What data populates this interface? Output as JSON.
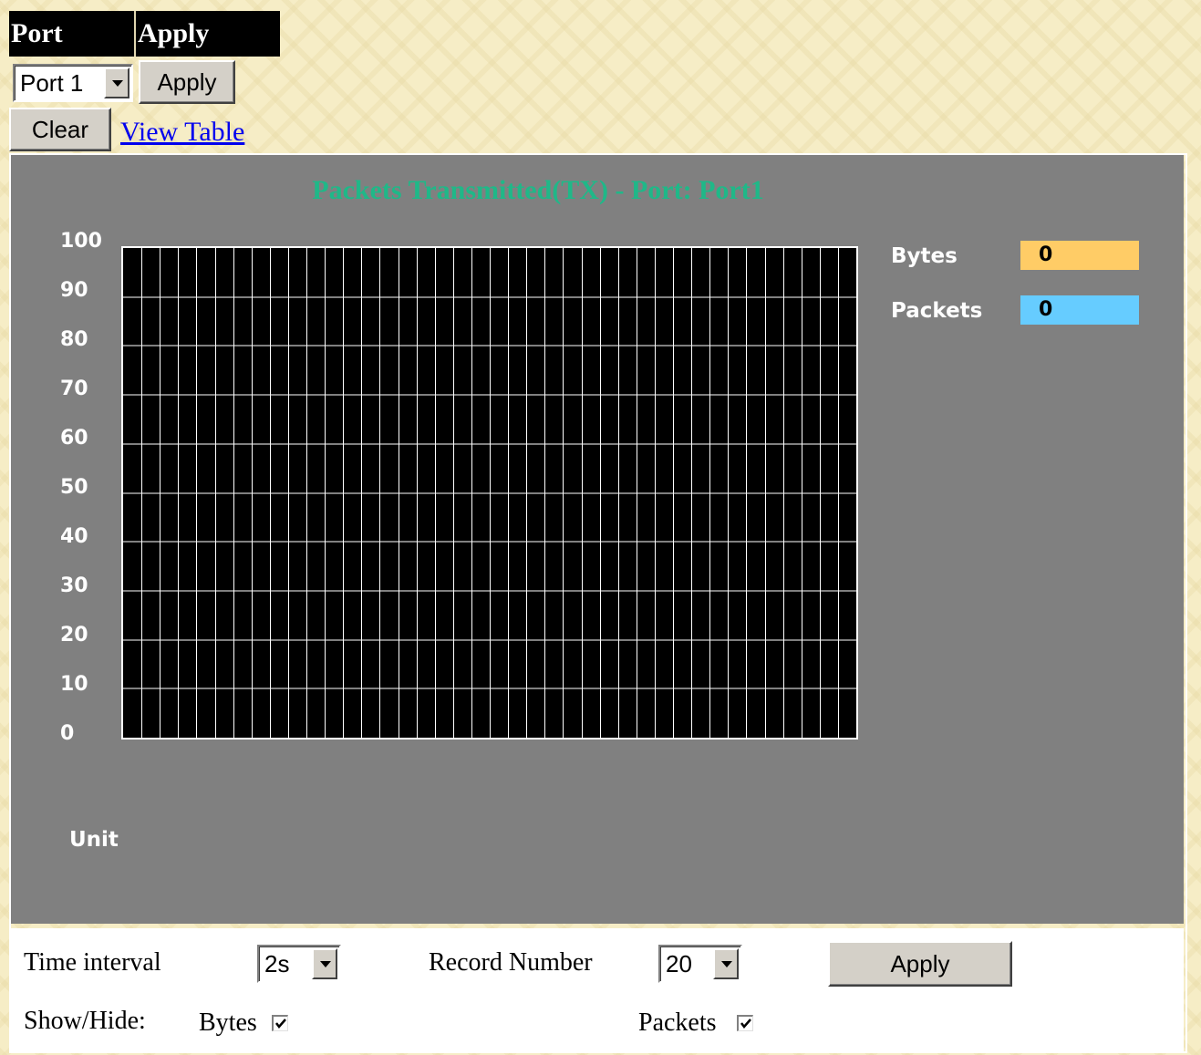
{
  "header": {
    "col1": "Port",
    "col2": "Apply"
  },
  "port_select": {
    "value": "Port 1"
  },
  "buttons": {
    "apply_top": "Apply",
    "clear": "Clear",
    "apply_bottom": "Apply"
  },
  "links": {
    "view_table": "View Table"
  },
  "chart_data": {
    "type": "line",
    "title": "Packets Transmitted(TX) - Port: Port1",
    "yticks": [
      "100",
      "90",
      "80",
      "70",
      "60",
      "50",
      "40",
      "30",
      "20",
      "10",
      "0"
    ],
    "ylim": [
      0,
      100
    ],
    "ylabel": "Unit",
    "grid": true,
    "vertical_gridlines": 39,
    "series": [
      {
        "name": "Bytes",
        "value": "0",
        "color": "#ffcc66",
        "values": []
      },
      {
        "name": "Packets",
        "value": "0",
        "color": "#66ccff",
        "values": []
      }
    ],
    "legend_placement": "right"
  },
  "controls": {
    "time_interval_label": "Time interval",
    "time_interval_value": "2s",
    "record_number_label": "Record Number",
    "record_number_value": "20",
    "show_hide_label": "Show/Hide:",
    "bytes_label": "Bytes",
    "bytes_checked": true,
    "packets_label": "Packets",
    "packets_checked": true
  }
}
